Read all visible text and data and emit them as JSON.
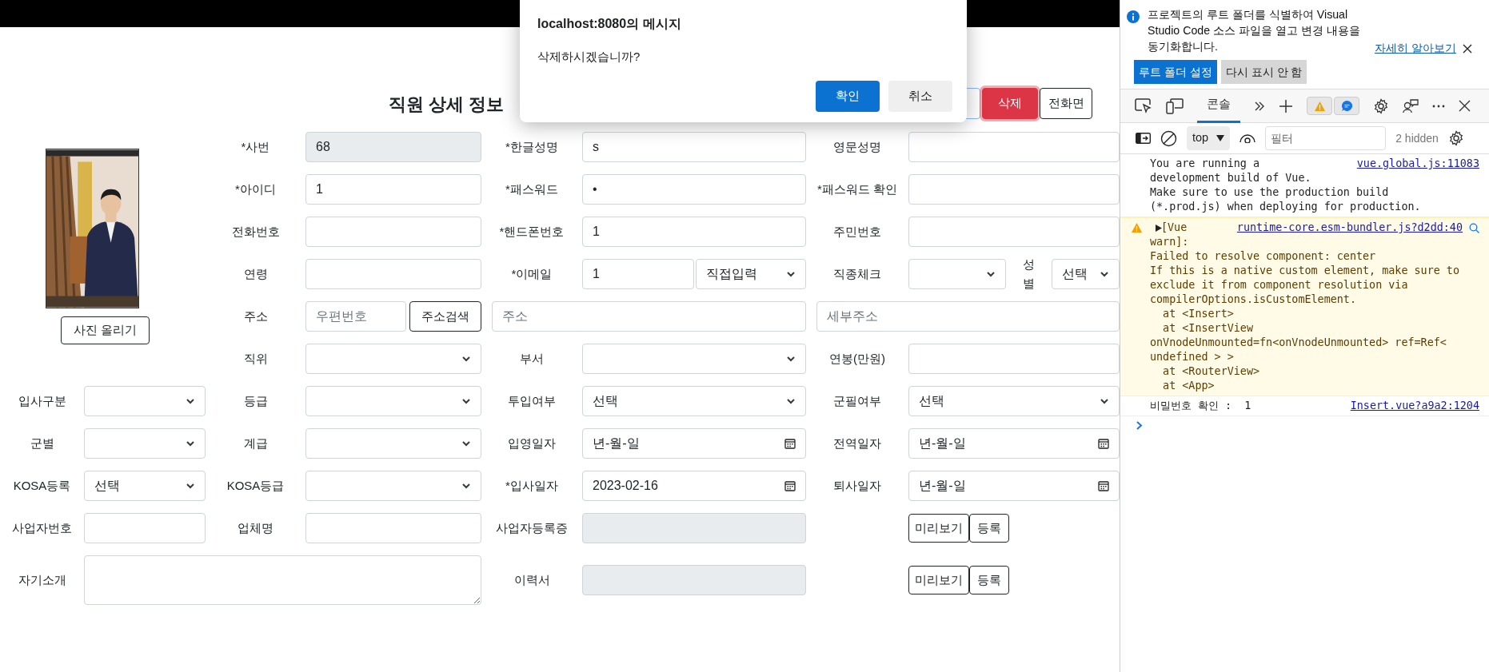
{
  "dialog": {
    "title": "localhost:8080의 메시지",
    "message": "삭제하시겠습니까?",
    "buttons": [
      {
        "label": "확인",
        "primary": true
      },
      {
        "label": "취소",
        "primary": false
      }
    ]
  },
  "page": {
    "title": "직원 상세 정보",
    "actions": [
      {
        "label": "삭제",
        "kind": "danger"
      },
      {
        "label": "전화면",
        "kind": "outline"
      }
    ],
    "photo_button": "사진 올리기",
    "rows": [
      {
        "fields": [
          {
            "label": "*사번",
            "kind": "readonly",
            "value": "68"
          },
          {
            "label": "*한글성명",
            "kind": "input",
            "value": "s"
          },
          {
            "label": "영문성명",
            "kind": "input"
          }
        ]
      },
      {
        "fields": [
          {
            "label": "*아이디",
            "kind": "input",
            "value": "1"
          },
          {
            "label": "*패스워드",
            "kind": "input",
            "value": "•"
          },
          {
            "label": "*패스워드 확인",
            "kind": "input"
          }
        ]
      },
      {
        "fields": [
          {
            "label": "전화번호",
            "kind": "input"
          },
          {
            "label": "*핸드폰번호",
            "kind": "input",
            "value": "1"
          },
          {
            "label": "주민번호",
            "kind": "input"
          }
        ]
      },
      {
        "fields": [
          {
            "label": "연령",
            "kind": "input"
          },
          {
            "label": "*이메일",
            "kind": "email",
            "value": "1",
            "domain": "직접입력"
          },
          {
            "label": "직종체크",
            "kind": "job_gender",
            "sub_label": "성별",
            "sub_value": "선택"
          }
        ]
      },
      {
        "fields": [
          {
            "label": "주소",
            "kind": "address",
            "postcode_placeholder": "우편번호",
            "search_button": "주소검색",
            "address_placeholder": "주소",
            "detail_placeholder": "세부주소"
          }
        ]
      },
      {
        "fields": [
          {
            "label": "직위",
            "kind": "select"
          },
          {
            "label": "부서",
            "kind": "select"
          },
          {
            "label": "연봉(만원)",
            "kind": "input"
          }
        ]
      },
      {
        "fields": [
          {
            "label": "입사구분",
            "kind": "select"
          },
          {
            "label": "등급",
            "kind": "select"
          },
          {
            "label": "투입여부",
            "kind": "select",
            "value": "선택"
          },
          {
            "label": "군필여부",
            "kind": "select",
            "value": "선택"
          }
        ]
      },
      {
        "fields": [
          {
            "label": "군별",
            "kind": "select"
          },
          {
            "label": "계급",
            "kind": "select"
          },
          {
            "label": "입영일자",
            "kind": "date",
            "value": "년-월-일"
          },
          {
            "label": "전역일자",
            "kind": "date",
            "value": "년-월-일"
          }
        ]
      },
      {
        "fields": [
          {
            "label": "KOSA등록",
            "kind": "select",
            "value": "선택"
          },
          {
            "label": "KOSA등급",
            "kind": "select"
          },
          {
            "label": "*입사일자",
            "kind": "date",
            "value": "2023-02-16"
          },
          {
            "label": "퇴사일자",
            "kind": "date",
            "value": "년-월-일"
          }
        ]
      },
      {
        "fields": [
          {
            "label": "사업자번호",
            "kind": "input"
          },
          {
            "label": "업체명",
            "kind": "input"
          },
          {
            "label": "사업자등록증",
            "kind": "readonly"
          },
          {
            "kind": "file_buttons",
            "buttons": [
              "미리보기",
              "등록"
            ]
          }
        ]
      },
      {
        "fields": [
          {
            "label": "자기소개",
            "kind": "textarea"
          },
          {
            "label": "이력서",
            "kind": "readonly"
          },
          {
            "kind": "file_buttons",
            "buttons": [
              "미리보기",
              "등록"
            ]
          }
        ]
      }
    ]
  },
  "devtools": {
    "notice": {
      "text": "프로젝트의 루트 폴더를 식별하여 Visual Studio Code 소스 파일을 열고 변경 내용을 동기화합니다.",
      "link": "자세히 알아보기",
      "buttons": [
        {
          "label": "루트 폴더 설정",
          "primary": true
        },
        {
          "label": "다시 표시 안 함",
          "primary": false
        }
      ]
    },
    "tabs": [
      {
        "label": "콘솔",
        "selected": true
      }
    ],
    "context": "top",
    "filter_placeholder": "필터",
    "hidden_count": "2 hidden",
    "messages": [
      {
        "kind": "log",
        "lines": [
          "You are running a",
          "development build of Vue.",
          "Make sure to use the production build",
          "(*.prod.js) when deploying for production."
        ],
        "source": "vue.global.js:11083"
      },
      {
        "kind": "warning",
        "lines": [
          "[Vue",
          "warn]:",
          "Failed to resolve component: center",
          "If this is a native custom element, make sure to",
          "exclude it from component resolution via",
          "compilerOptions.isCustomElement.",
          "  at <Insert>",
          "  at <InsertView",
          "onVnodeUnmounted=fn<onVnodeUnmounted> ref=Ref<",
          "undefined > >",
          "  at <RouterView>",
          "  at <App>"
        ],
        "source": "runtime-core.esm-bundler.js?d2dd:40"
      },
      {
        "kind": "log",
        "lines": [
          "비밀번호 확인 :  1"
        ],
        "source": "Insert.vue?a9a2:1204"
      }
    ]
  }
}
